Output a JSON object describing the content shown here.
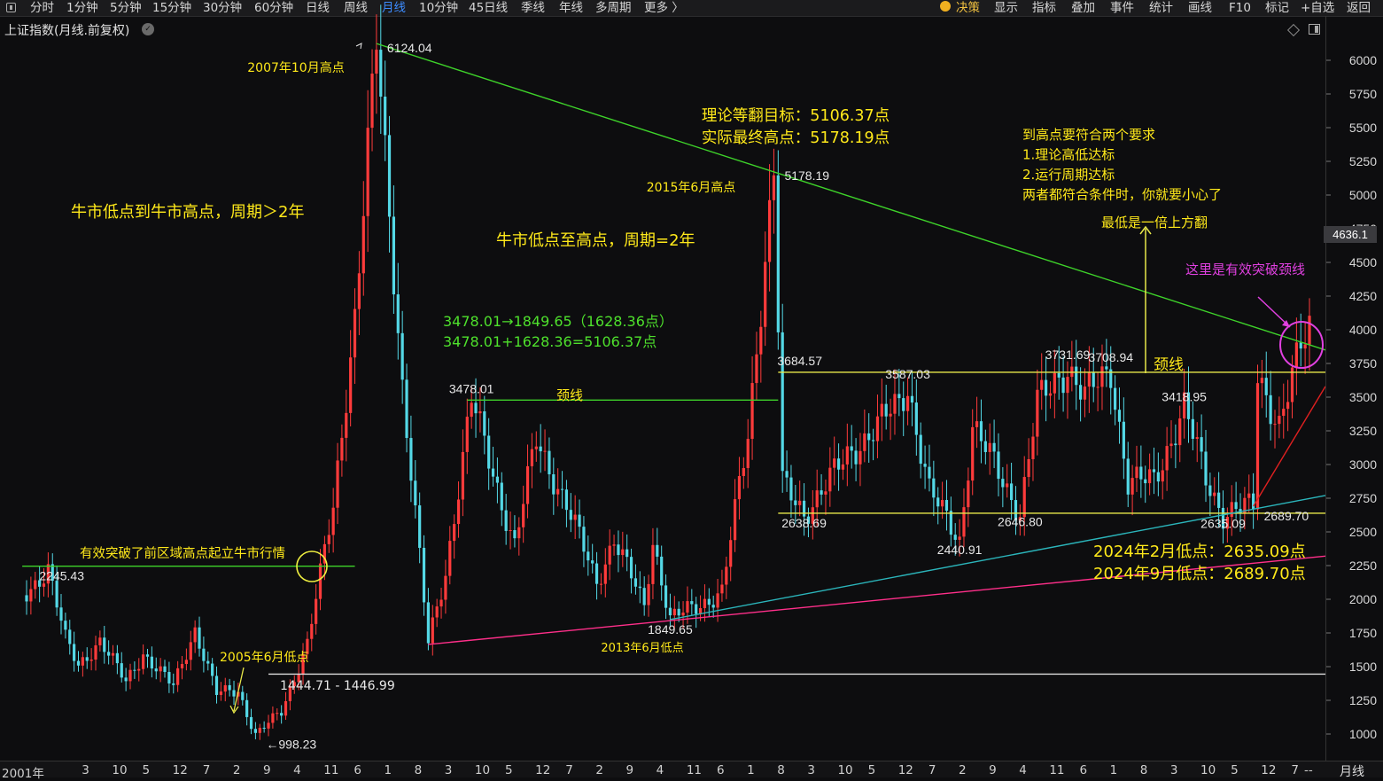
{
  "toolbar": {
    "left_items": [
      "分时",
      "1分钟",
      "5分钟",
      "15分钟",
      "30分钟",
      "60分钟",
      "日线",
      "周线",
      "月线",
      "10分钟",
      "45日线",
      "季线",
      "年线",
      "多周期",
      "更多 〉"
    ],
    "active_item": "月线",
    "right_items": [
      "决策",
      "显示",
      "指标",
      "叠加",
      "事件",
      "统计",
      "画线",
      "F10",
      "标记",
      "+自选",
      "返回"
    ]
  },
  "chart_title": "上证指数(月线.前复权)",
  "current_price_label": "4636.1",
  "colors": {
    "background": "#0d0d0f",
    "up_candle": "#ff3b3b",
    "down_candle": "#54d8e6",
    "trendline_green": "#3ed22a",
    "support_yellow": "#e8e84a",
    "pink_line": "#ff2f8a",
    "teal_line": "#2bb5bb",
    "red_line": "#e02020",
    "annotation_yellow": "#ffe91a",
    "annotation_green": "#4ee02c",
    "annotation_magenta": "#e040e0"
  },
  "chart_data": {
    "type": "candlestick",
    "timeframe": "monthly",
    "y_axis": {
      "min": 900,
      "max": 6130,
      "ticks": [
        1000,
        1250,
        1500,
        1750,
        2000,
        2250,
        2500,
        2750,
        3000,
        3250,
        3500,
        3750,
        4000,
        4250,
        4500,
        4750,
        5000,
        5250,
        5500,
        5750,
        6000
      ]
    },
    "x_axis": {
      "start": "2001-01",
      "end": "2025-10",
      "tick_labels": [
        {
          "label": "2001年",
          "date": "2001-01"
        },
        {
          "label": "3",
          "date": "2002-03"
        },
        {
          "label": "10",
          "date": "2002-10"
        },
        {
          "label": "5",
          "date": "2003-05"
        },
        {
          "label": "12",
          "date": "2003-12"
        },
        {
          "label": "7",
          "date": "2004-07"
        },
        {
          "label": "2",
          "date": "2005-02"
        },
        {
          "label": "9",
          "date": "2005-09"
        },
        {
          "label": "4",
          "date": "2006-04"
        },
        {
          "label": "11",
          "date": "2006-11"
        },
        {
          "label": "6",
          "date": "2007-06"
        },
        {
          "label": "1",
          "date": "2008-01"
        },
        {
          "label": "8",
          "date": "2008-08"
        },
        {
          "label": "3",
          "date": "2009-03"
        },
        {
          "label": "10",
          "date": "2009-10"
        },
        {
          "label": "5",
          "date": "2010-05"
        },
        {
          "label": "12",
          "date": "2010-12"
        },
        {
          "label": "7",
          "date": "2011-07"
        },
        {
          "label": "2",
          "date": "2012-02"
        },
        {
          "label": "9",
          "date": "2012-09"
        },
        {
          "label": "4",
          "date": "2013-04"
        },
        {
          "label": "11",
          "date": "2013-11"
        },
        {
          "label": "6",
          "date": "2014-06"
        },
        {
          "label": "1",
          "date": "2015-01"
        },
        {
          "label": "8",
          "date": "2015-08"
        },
        {
          "label": "3",
          "date": "2016-03"
        },
        {
          "label": "10",
          "date": "2016-10"
        },
        {
          "label": "5",
          "date": "2017-05"
        },
        {
          "label": "12",
          "date": "2017-12"
        },
        {
          "label": "7",
          "date": "2018-07"
        },
        {
          "label": "2",
          "date": "2019-02"
        },
        {
          "label": "9",
          "date": "2019-09"
        },
        {
          "label": "4",
          "date": "2020-04"
        },
        {
          "label": "11",
          "date": "2020-11"
        },
        {
          "label": "6",
          "date": "2021-06"
        },
        {
          "label": "1",
          "date": "2022-01"
        },
        {
          "label": "8",
          "date": "2022-08"
        },
        {
          "label": "3",
          "date": "2023-03"
        },
        {
          "label": "10",
          "date": "2023-10"
        },
        {
          "label": "5",
          "date": "2024-05"
        },
        {
          "label": "12",
          "date": "2024-12"
        },
        {
          "label": "7",
          "date": "2025-07"
        },
        {
          "label": "--",
          "date": "2025-10"
        }
      ],
      "period_label": "月线"
    },
    "price_path": [
      [
        "2001-01",
        2030
      ],
      [
        "2001-06",
        2245.43
      ],
      [
        "2001-10",
        1700
      ],
      [
        "2002-01",
        1500
      ],
      [
        "2002-06",
        1700
      ],
      [
        "2002-12",
        1380
      ],
      [
        "2003-04",
        1600
      ],
      [
        "2003-11",
        1350
      ],
      [
        "2004-04",
        1780
      ],
      [
        "2004-09",
        1300
      ],
      [
        "2005-02",
        1320
      ],
      [
        "2005-06",
        998.23
      ],
      [
        "2005-12",
        1160
      ],
      [
        "2006-06",
        1680
      ],
      [
        "2006-12",
        2675
      ],
      [
        "2007-05",
        4110
      ],
      [
        "2007-10",
        6124.04
      ],
      [
        "2008-04",
        3600
      ],
      [
        "2008-10",
        1664.93
      ],
      [
        "2009-02",
        2200
      ],
      [
        "2009-08",
        3478.01
      ],
      [
        "2010-06",
        2400
      ],
      [
        "2010-11",
        3186
      ],
      [
        "2011-06",
        2700
      ],
      [
        "2012-01",
        2130
      ],
      [
        "2012-05",
        2450
      ],
      [
        "2012-12",
        1949
      ],
      [
        "2013-02",
        2444
      ],
      [
        "2013-06",
        1849.65
      ],
      [
        "2014-06",
        2050
      ],
      [
        "2014-12",
        3234
      ],
      [
        "2015-06",
        5178.19
      ],
      [
        "2015-08",
        2850
      ],
      [
        "2016-01",
        2638.69
      ],
      [
        "2016-12",
        3100
      ],
      [
        "2017-11",
        3450
      ],
      [
        "2018-01",
        3587.03
      ],
      [
        "2018-06",
        2800
      ],
      [
        "2019-01",
        2440.91
      ],
      [
        "2019-04",
        3288
      ],
      [
        "2020-03",
        2646.8
      ],
      [
        "2020-07",
        3450
      ],
      [
        "2021-02",
        3731.69
      ],
      [
        "2021-06",
        3500
      ],
      [
        "2021-12",
        3708.94
      ],
      [
        "2022-04",
        2863
      ],
      [
        "2022-10",
        2885
      ],
      [
        "2023-05",
        3418.95
      ],
      [
        "2023-10",
        2900
      ],
      [
        "2024-02",
        2635.09
      ],
      [
        "2024-09",
        2689.7
      ],
      [
        "2024-10",
        3674
      ],
      [
        "2025-03",
        3300
      ],
      [
        "2025-08",
        3857
      ],
      [
        "2025-10",
        4034
      ]
    ],
    "price_labels": [
      {
        "text": "6124.04",
        "date": "2007-10",
        "value": 6124.04,
        "anchor": "right"
      },
      {
        "text": "5178.19",
        "date": "2015-06",
        "value": 5178.19,
        "anchor": "right"
      },
      {
        "text": "3478.01",
        "date": "2009-08",
        "value": 3478.01,
        "anchor": "center"
      },
      {
        "text": "3684.57",
        "date": "2015-12",
        "value": 3684.57,
        "anchor": "center"
      },
      {
        "text": "3587.03",
        "date": "2018-01",
        "value": 3587.03,
        "anchor": "center"
      },
      {
        "text": "3731.69",
        "date": "2021-02",
        "value": 3731.69,
        "anchor": "center"
      },
      {
        "text": "3708.94",
        "date": "2021-12",
        "value": 3708.94,
        "anchor": "center"
      },
      {
        "text": "3418.95",
        "date": "2023-05",
        "value": 3418.95,
        "anchor": "center"
      },
      {
        "text": "2245.43",
        "date": "2001-06",
        "value": 2245.43,
        "anchor": "left"
      },
      {
        "text": "1849.65",
        "date": "2013-06",
        "value": 1849.65,
        "anchor": "center"
      },
      {
        "text": "2638.69",
        "date": "2016-01",
        "value": 2638.69,
        "anchor": "center"
      },
      {
        "text": "2440.91",
        "date": "2019-01",
        "value": 2440.91,
        "anchor": "center"
      },
      {
        "text": "2646.80",
        "date": "2020-03",
        "value": 2646.8,
        "anchor": "center"
      },
      {
        "text": "2635.09",
        "date": "2024-02",
        "value": 2635.09,
        "anchor": "center"
      },
      {
        "text": "2689.70",
        "date": "2024-09",
        "value": 2689.7,
        "anchor": "right"
      },
      {
        "text": "←998.23",
        "date": "2005-06",
        "value": 998.23,
        "anchor": "right"
      }
    ],
    "lines": [
      {
        "name": "green-downtrend",
        "color": "#3ed22a",
        "from": [
          "2007-10",
          6124.04
        ],
        "to": [
          "2026-03",
          3850
        ]
      },
      {
        "name": "neckline-2009",
        "color": "#3ed22a",
        "from": [
          "2009-07",
          3478.01
        ],
        "to": [
          "2015-07",
          3478.01
        ]
      },
      {
        "name": "breakout-2005",
        "color": "#3ed22a",
        "from": [
          "2000-12",
          2245.43
        ],
        "to": [
          "2007-05",
          2245.43
        ]
      },
      {
        "name": "neckline-yellow",
        "color": "#e8e84a",
        "from": [
          "2015-07",
          3684.57
        ],
        "to": [
          "2026-03",
          3684.57
        ]
      },
      {
        "name": "support-yellow",
        "color": "#e8e84a",
        "from": [
          "2015-07",
          2638.69
        ],
        "to": [
          "2026-03",
          2638.69
        ]
      },
      {
        "name": "range-1444",
        "color": "#dddddd",
        "from": [
          "2005-09",
          1444.71
        ],
        "to": [
          "2026-03",
          1444.71
        ]
      },
      {
        "name": "pink-support",
        "color": "#ff2f8a",
        "from": [
          "2008-10",
          1664.93
        ],
        "to": [
          "2026-03",
          2320
        ]
      },
      {
        "name": "teal-support",
        "color": "#2bb5bb",
        "from": [
          "2013-06",
          1849.65
        ],
        "to": [
          "2026-03",
          2770
        ]
      },
      {
        "name": "red-uptrend",
        "color": "#e02020",
        "from": [
          "2024-09",
          2689.7
        ],
        "to": [
          "2026-03",
          3580
        ]
      }
    ]
  },
  "annotations": {
    "peak_2007": "2007年10月高点",
    "peak_2015": "2015年6月高点",
    "target_title": "理论等翻目标：5106.37点",
    "actual_title": "实际最终高点：5178.19点",
    "requirements": [
      "到高点要符合两个要求",
      "1.理论高低达标",
      "2.运行周期达标",
      "两者都符合条件时，你就要小心了"
    ],
    "bull_period_1": "牛市低点到牛市高点，周期＞2年",
    "bull_period_2": "牛市低点至高点，周期=2年",
    "double_up": "最低是一倍上方翻",
    "breakout_neck": "这里是有效突破颈线",
    "calc_1": "3478.01→1849.65（1628.36点）",
    "calc_2": "3478.01+1628.36=5106.37点",
    "neckline_green": "颈线",
    "neckline_yellow": "颈线",
    "breakout_2005": "有效突破了前区域高点起立牛市行情",
    "low_2005": "2005年6月低点",
    "range_1444": "1444.71 - 1446.99",
    "low_2013": "2013年6月低点",
    "low_2024_feb": "2024年2月低点：2635.09点",
    "low_2024_sep": "2024年9月低点：2689.70点"
  }
}
